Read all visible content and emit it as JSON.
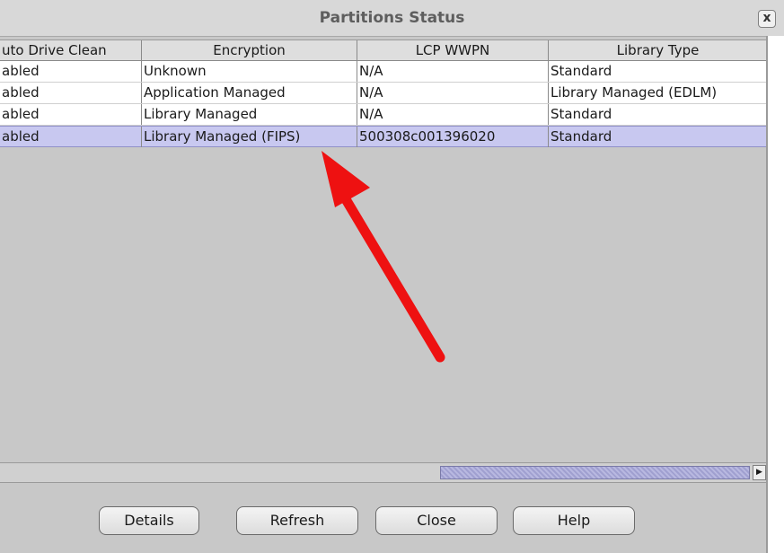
{
  "window": {
    "title": "Partitions Status",
    "close_label": "x"
  },
  "table": {
    "columns": [
      "uto Drive Clean",
      "Encryption",
      "LCP WWPN",
      "Library Type"
    ],
    "rows": [
      [
        "abled",
        "Unknown",
        "N/A",
        "Standard"
      ],
      [
        "abled",
        "Application Managed",
        "N/A",
        "Library Managed (EDLM)"
      ],
      [
        "abled",
        "Library Managed",
        "N/A",
        "Standard"
      ],
      [
        "abled",
        "Library Managed (FIPS)",
        "500308c001396020",
        "Standard"
      ]
    ],
    "selected_row": 3
  },
  "buttons": {
    "details": "Details",
    "refresh": "Refresh",
    "close": "Close",
    "help": "Help"
  },
  "colors": {
    "annotation_arrow": "#ee1111",
    "selection": "#c8c8f0"
  }
}
